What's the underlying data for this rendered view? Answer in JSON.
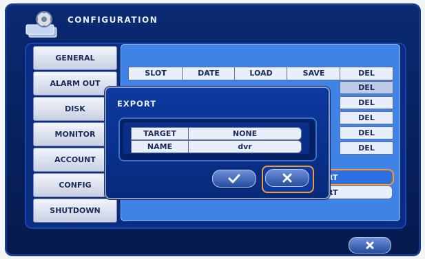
{
  "window": {
    "title": "CONFIGURATION",
    "logo_icon": "config-app-icon"
  },
  "sidebar": {
    "items": [
      {
        "label": "GENERAL"
      },
      {
        "label": "ALARM OUT"
      },
      {
        "label": "DISK"
      },
      {
        "label": "MONITOR"
      },
      {
        "label": "ACCOUNT"
      },
      {
        "label": "CONFIG"
      },
      {
        "label": "SHUTDOWN"
      }
    ]
  },
  "table": {
    "headers": [
      "SLOT",
      "DATE",
      "LOAD",
      "SAVE",
      "DEL"
    ],
    "del_cells": [
      "DEL",
      "DEL",
      "DEL",
      "DEL",
      "DEL"
    ],
    "port_fragments": [
      "RT",
      "RT"
    ]
  },
  "dialog": {
    "title": "EXPORT",
    "fields": [
      {
        "label": "TARGET",
        "value": "NONE"
      },
      {
        "label": "NAME",
        "value": "dvr"
      }
    ],
    "ok_icon": "check-icon",
    "cancel_icon": "close-icon"
  },
  "footer": {
    "close_icon": "close-icon"
  },
  "colors": {
    "background": "#07205c",
    "panel": "#3f83e6",
    "accent": "#f19a3a",
    "selected_row": "#2d6fe0"
  }
}
